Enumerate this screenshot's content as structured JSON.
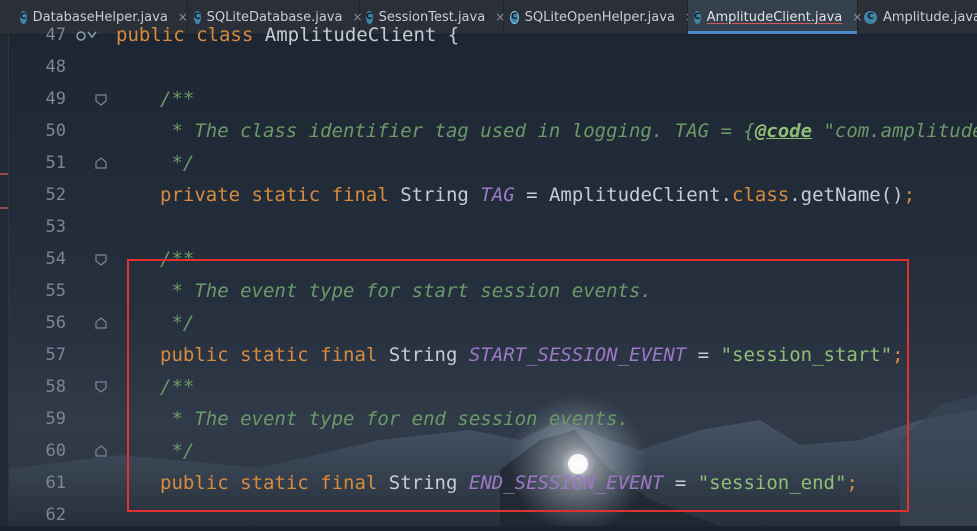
{
  "tabs": [
    {
      "label": "DatabaseHelper.java",
      "icon": "class-icon",
      "active": false,
      "closable": true
    },
    {
      "label": "SQLiteDatabase.java",
      "icon": "class-icon",
      "active": false,
      "closable": true
    },
    {
      "label": "SessionTest.java",
      "icon": "class-icon",
      "active": false,
      "closable": true
    },
    {
      "label": "SQLiteOpenHelper.java",
      "icon": "class-icon",
      "active": false,
      "closable": true
    },
    {
      "label": "AmplitudeClient.java",
      "icon": "class-icon",
      "active": true,
      "closable": true
    },
    {
      "label": "Amplitude.java",
      "icon": "class-icon",
      "active": false,
      "closable": false
    }
  ],
  "close_glyph": "×",
  "line_numbers": [
    "47",
    "48",
    "49",
    "50",
    "51",
    "52",
    "53",
    "54",
    "55",
    "56",
    "57",
    "58",
    "59",
    "60",
    "61",
    "62"
  ],
  "code": {
    "l47": {
      "kw1": "public",
      "kw2": "class",
      "name": "AmplitudeClient",
      "brace": "{"
    },
    "l49": {
      "text": "/**"
    },
    "l50": {
      "text": " * The class identifier tag used in logging. TAG = {",
      "tag": "@code",
      "rest": " \"com.amplitude.ap"
    },
    "l51": {
      "text": " */"
    },
    "l52": {
      "kw": "private static final",
      "type": "String",
      "name": "TAG",
      "eq": " = ",
      "cls": "AmplitudeClient.",
      "classkw": "class",
      "call": ".getName()",
      "semi": ";"
    },
    "l54": {
      "text": "/**"
    },
    "l55": {
      "text": " * The event type for start session events."
    },
    "l56": {
      "text": " */"
    },
    "l57": {
      "kw": "public static final",
      "type": "String",
      "name": "START_SESSION_EVENT",
      "eq": " = ",
      "value": "\"session_start\"",
      "semi": ";"
    },
    "l58": {
      "text": "/**"
    },
    "l59": {
      "text": " * The event type for end session events."
    },
    "l60": {
      "text": " */"
    },
    "l61": {
      "kw": "public static final",
      "type": "String",
      "name": "END_SESSION_EVENT",
      "eq": " = ",
      "value": "\"session_end\"",
      "semi": ";"
    }
  },
  "colors": {
    "keyword": "#d88b3f",
    "comment": "#6a9a68",
    "string": "#8fbf76",
    "constant": "#9d78c7",
    "highlight_box": "#e3312f",
    "active_tab_indicator": "#4a88c7"
  }
}
